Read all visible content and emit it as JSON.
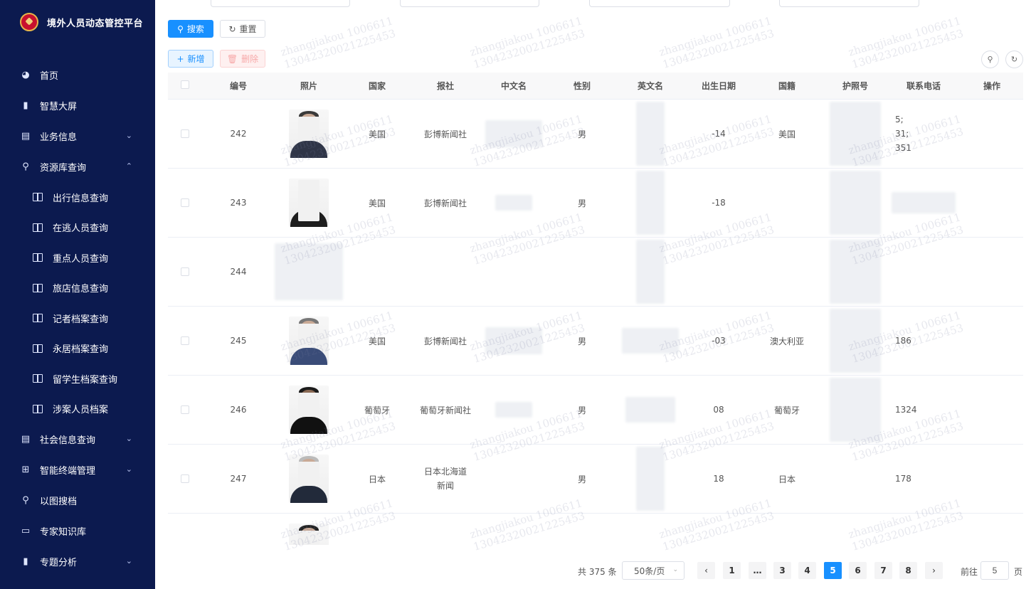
{
  "app": {
    "title": "境外人员动态管控平台"
  },
  "sidebar": {
    "items": [
      {
        "label": "首页",
        "icon": "dashboard-icon",
        "glyph": "◕"
      },
      {
        "label": "智慧大屏",
        "icon": "bar-chart-icon",
        "glyph": "▮"
      },
      {
        "label": "业务信息",
        "icon": "book-icon",
        "glyph": "▤",
        "chevron": "⌄"
      },
      {
        "label": "资源库查询",
        "icon": "search-icon",
        "glyph": "⚲",
        "chevron": "⌃"
      }
    ],
    "sub_items": [
      {
        "label": "出行信息查询"
      },
      {
        "label": "在逃人员查询"
      },
      {
        "label": "重点人员查询"
      },
      {
        "label": "旅店信息查询"
      },
      {
        "label": "记者档案查询"
      },
      {
        "label": "永居档案查询"
      },
      {
        "label": "留学生档案查询"
      },
      {
        "label": "涉案人员档案"
      }
    ],
    "items_bottom": [
      {
        "label": "社会信息查询",
        "icon": "book-icon",
        "glyph": "▤",
        "chevron": "⌄"
      },
      {
        "label": "智能终端管理",
        "icon": "org-chart-icon",
        "glyph": "⊞",
        "chevron": "⌄"
      },
      {
        "label": "以图搜档",
        "icon": "search-icon",
        "glyph": "⚲"
      },
      {
        "label": "专家知识库",
        "icon": "chat-icon",
        "glyph": "▭"
      },
      {
        "label": "专题分析",
        "icon": "bar-chart-icon",
        "glyph": "▮",
        "chevron": "⌄"
      }
    ]
  },
  "toolbar": {
    "search_label": "搜索",
    "reset_label": "重置",
    "add_label": "新增",
    "delete_label": "删除"
  },
  "table": {
    "headers": [
      "编号",
      "照片",
      "国家",
      "报社",
      "中文名",
      "性别",
      "英文名",
      "出生日期",
      "国籍",
      "护照号",
      "联系电话",
      "操作"
    ],
    "rows": [
      {
        "id": "242",
        "country": "美国",
        "press": "彭博新闻社",
        "gender": "男",
        "birth": "-14",
        "nationality": "美国",
        "phone_l1": "5;",
        "phone_l2": "31;",
        "phone_l3": "351"
      },
      {
        "id": "243",
        "country": "美国",
        "press": "彭博新闻社",
        "gender": "男",
        "birth": "-18",
        "nationality": "",
        "phone_l1": "",
        "phone_l2": "",
        "phone_l3": ""
      },
      {
        "id": "244",
        "country": "",
        "press": "",
        "gender": "",
        "birth": "",
        "nationality": "",
        "phone_l1": "",
        "phone_l2": "",
        "phone_l3": ""
      },
      {
        "id": "245",
        "country": "美国",
        "press": "彭博新闻社",
        "gender": "男",
        "birth": "-03",
        "nationality": "澳大利亚",
        "phone_l1": "186",
        "phone_l2": "",
        "phone_l3": ""
      },
      {
        "id": "246",
        "country": "葡萄牙",
        "press": "葡萄牙新闻社",
        "gender": "男",
        "birth": "08",
        "nationality": "葡萄牙",
        "phone_l1": "1324",
        "phone_l2": "",
        "phone_l3": ""
      },
      {
        "id": "247",
        "country": "日本",
        "press": "日本北海道新闻",
        "gender": "男",
        "birth": "18",
        "nationality": "日本",
        "phone_l1": "178",
        "phone_l2": "",
        "phone_l3": ""
      }
    ]
  },
  "pagination": {
    "total": "共 375 条",
    "page_size": "50条/页",
    "pages": [
      "1",
      "…",
      "3",
      "4",
      "5",
      "6",
      "7",
      "8"
    ],
    "prev": "‹",
    "next": "›",
    "goto_label": "前往",
    "goto_value": "5",
    "page_word": "页"
  },
  "colors": {
    "sidebar_bg": "#0c1a4f",
    "primary": "#1890ff",
    "danger_light": "#fef0f0"
  }
}
